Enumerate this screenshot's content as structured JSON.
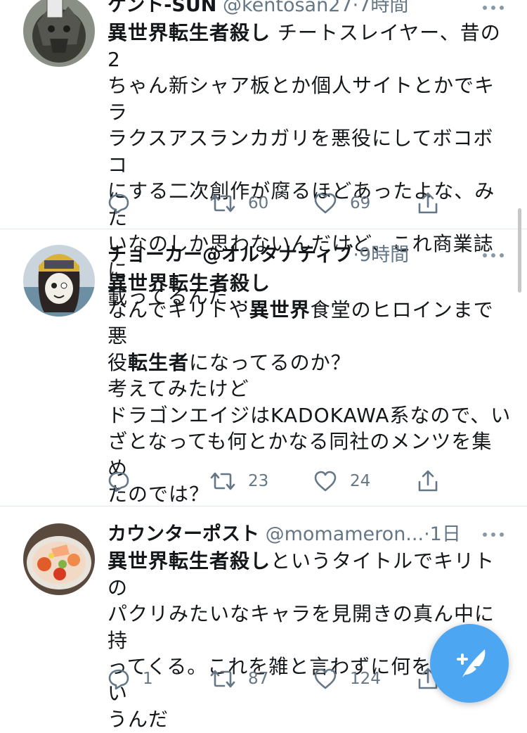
{
  "tweets": [
    {
      "name": "ケント-SUN",
      "handle": "@kentosan27",
      "time": "7時間",
      "lines": [
        [
          {
            "t": "異世界転生者殺し",
            "b": true
          },
          {
            "t": " チートスレイヤー、昔の2"
          }
        ],
        [
          {
            "t": "ちゃん新シャア板とか個人サイトとかでキラ"
          }
        ],
        [
          {
            "t": "ラクスアスランカガリを悪役にしてボコボコ"
          }
        ],
        [
          {
            "t": "にする二次創作が腐るほどあったよな、みた"
          }
        ],
        [
          {
            "t": "いなのしか思わないんだけど、これ商業誌に"
          }
        ],
        [
          {
            "t": "載ってるんだ..."
          }
        ]
      ],
      "reply_count": "",
      "retweet_count": "60",
      "like_count": "69"
    },
    {
      "name": "チョーカー@オルタナティブ",
      "handle": "",
      "time": "9時間",
      "lines": [
        [
          {
            "t": "異世界転生者殺し",
            "b": true
          }
        ],
        [
          {
            "t": "なんでキリトや"
          },
          {
            "t": "異世界",
            "b": true
          },
          {
            "t": "食堂のヒロインまで悪"
          }
        ],
        [
          {
            "t": "役"
          },
          {
            "t": "転生者",
            "b": true
          },
          {
            "t": "になってるのか？"
          }
        ],
        [
          {
            "t": "考えてみたけど"
          }
        ],
        [
          {
            "t": "ドラゴンエイジはKADOKAWA系なので、い"
          }
        ],
        [
          {
            "t": "ざとなっても何とかなる同社のメンツを集め"
          }
        ],
        [
          {
            "t": "たのでは？"
          }
        ]
      ],
      "reply_count": "",
      "retweet_count": "23",
      "like_count": "24"
    },
    {
      "name": "カウンターポスト",
      "handle": "@momameron...",
      "time": "1日",
      "lines": [
        [
          {
            "t": "異世界転生者殺し",
            "b": true
          },
          {
            "t": "というタイトルでキリトの"
          }
        ],
        [
          {
            "t": "パクリみたいなキャラを見開きの真ん中に持"
          }
        ],
        [
          {
            "t": "ってくる。これを雑と言わずに何を雑ってい"
          }
        ],
        [
          {
            "t": "うんだ"
          }
        ]
      ],
      "reply_count": "1",
      "retweet_count": "87",
      "like_count": "124"
    }
  ],
  "dot": "·",
  "colors": {
    "accent": "#4da6f1",
    "meta": "#657786",
    "separator": "#e1e8ed"
  },
  "icons": [
    "reply-icon",
    "retweet-icon",
    "like-icon",
    "share-icon",
    "more-icon",
    "compose-icon"
  ]
}
